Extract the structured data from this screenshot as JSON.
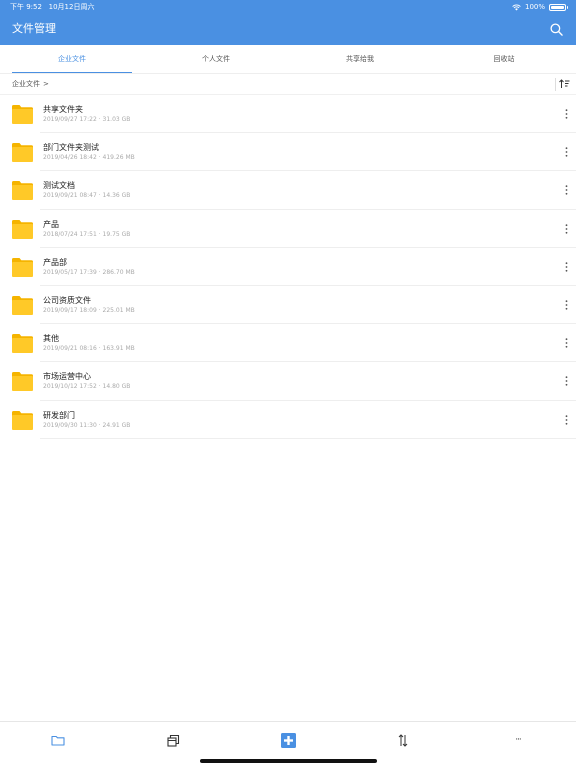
{
  "status_bar": {
    "time": "下午 9:52",
    "date": "10月12日周六",
    "battery": "100%",
    "battery_level": 1.0
  },
  "header": {
    "title": "文件管理",
    "search_icon": "search-icon"
  },
  "tabs": [
    {
      "label": "企业文件",
      "active": true
    },
    {
      "label": "个人文件",
      "active": false
    },
    {
      "label": "共享给我",
      "active": false
    },
    {
      "label": "回收站",
      "active": false
    }
  ],
  "breadcrumb": {
    "path": "企业文件",
    "chevron": ">"
  },
  "files": [
    {
      "name": "共享文件夹",
      "date": "2019/09/27 17:22",
      "size": "31.03 GB"
    },
    {
      "name": "部门文件夹测试",
      "date": "2019/04/26 18:42",
      "size": "419.26 MB"
    },
    {
      "name": "测试文档",
      "date": "2019/09/21 08:47",
      "size": "14.36 GB"
    },
    {
      "name": "产品",
      "date": "2018/07/24 17:51",
      "size": "19.75 GB"
    },
    {
      "name": "产品部",
      "date": "2019/05/17 17:39",
      "size": "286.70 MB"
    },
    {
      "name": "公司资质文件",
      "date": "2019/09/17 18:09",
      "size": "225.01 MB"
    },
    {
      "name": "其他",
      "date": "2019/09/21 08:16",
      "size": "163.91 MB"
    },
    {
      "name": "市场运营中心",
      "date": "2019/10/12 17:52",
      "size": "14.80 GB"
    },
    {
      "name": "研发部门",
      "date": "2019/09/30 11:30",
      "size": "24.91 GB"
    }
  ],
  "meta_separator": "·",
  "toolbar": {
    "items": [
      "folder-icon",
      "copy-icon",
      "add-icon",
      "sort-icon",
      "more-icon"
    ],
    "more_label": "···"
  },
  "colors": {
    "accent": "#4a90e2",
    "folder": "#ffc928",
    "folder_tab": "#f5b400"
  }
}
